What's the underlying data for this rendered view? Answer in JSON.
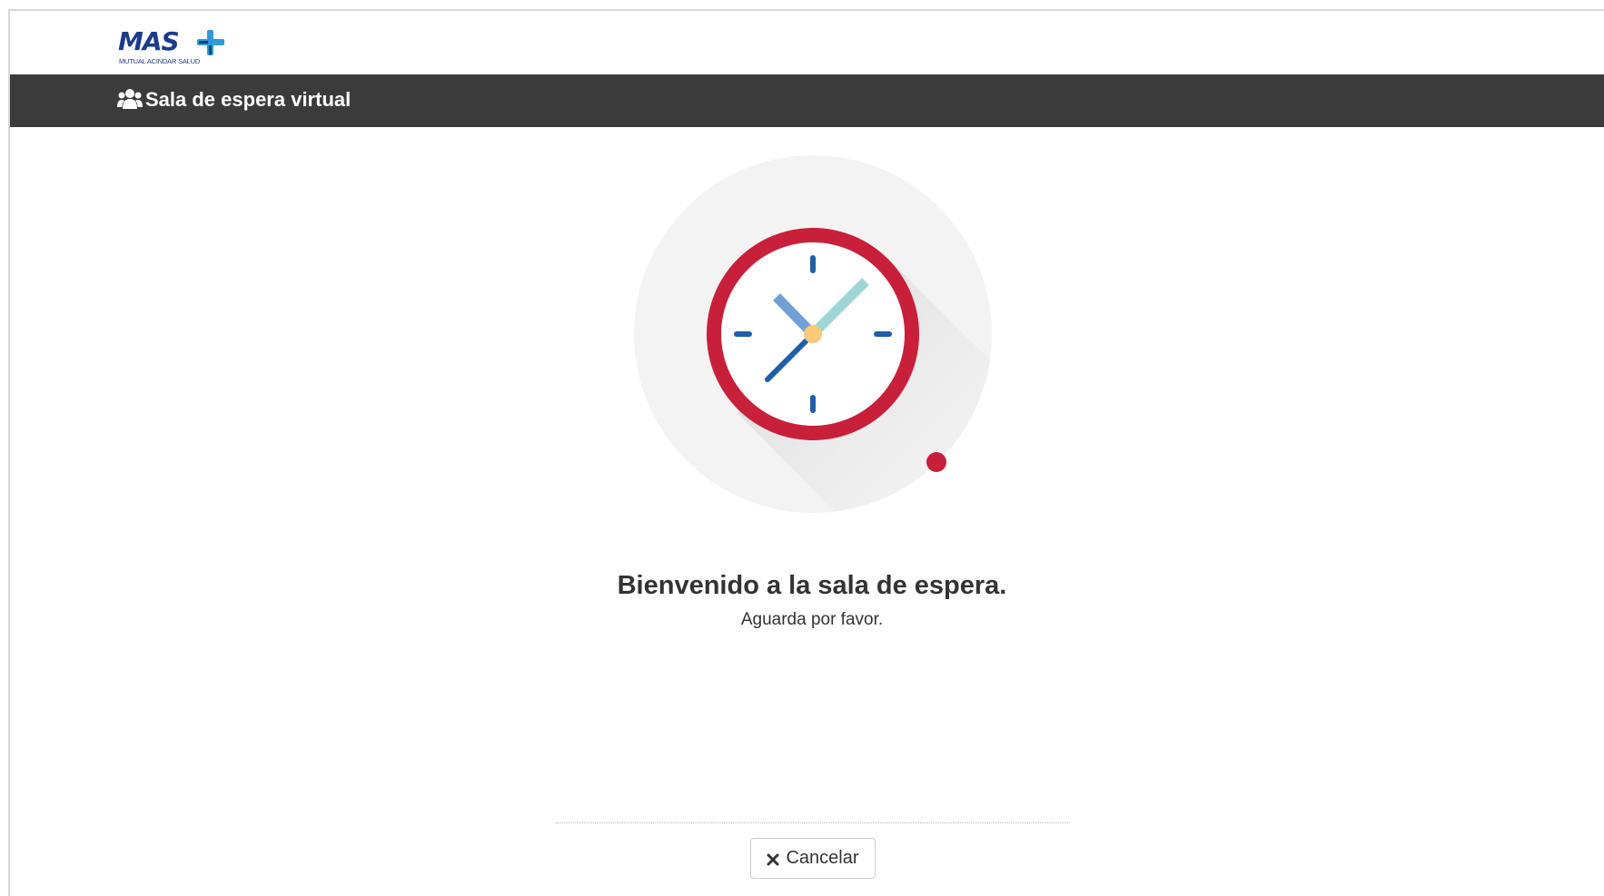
{
  "brand": {
    "logo_text": "MAS",
    "logo_subtitle": "MUTUAL ACINDAR SALUD",
    "primary_color": "#1b3c8c",
    "accent_color": "#2f9ad6"
  },
  "header": {
    "icon": "users-icon",
    "title": "Sala de espera virtual",
    "background_color": "#3b3b3b"
  },
  "illustration": {
    "icon": "clock-icon",
    "ring_color": "#c8203a",
    "tick_color": "#1f5ea8"
  },
  "main": {
    "title": "Bienvenido a la sala de espera.",
    "subtitle": "Aguarda por favor."
  },
  "footer": {
    "cancel_icon": "close-icon",
    "cancel_label": "Cancelar"
  }
}
